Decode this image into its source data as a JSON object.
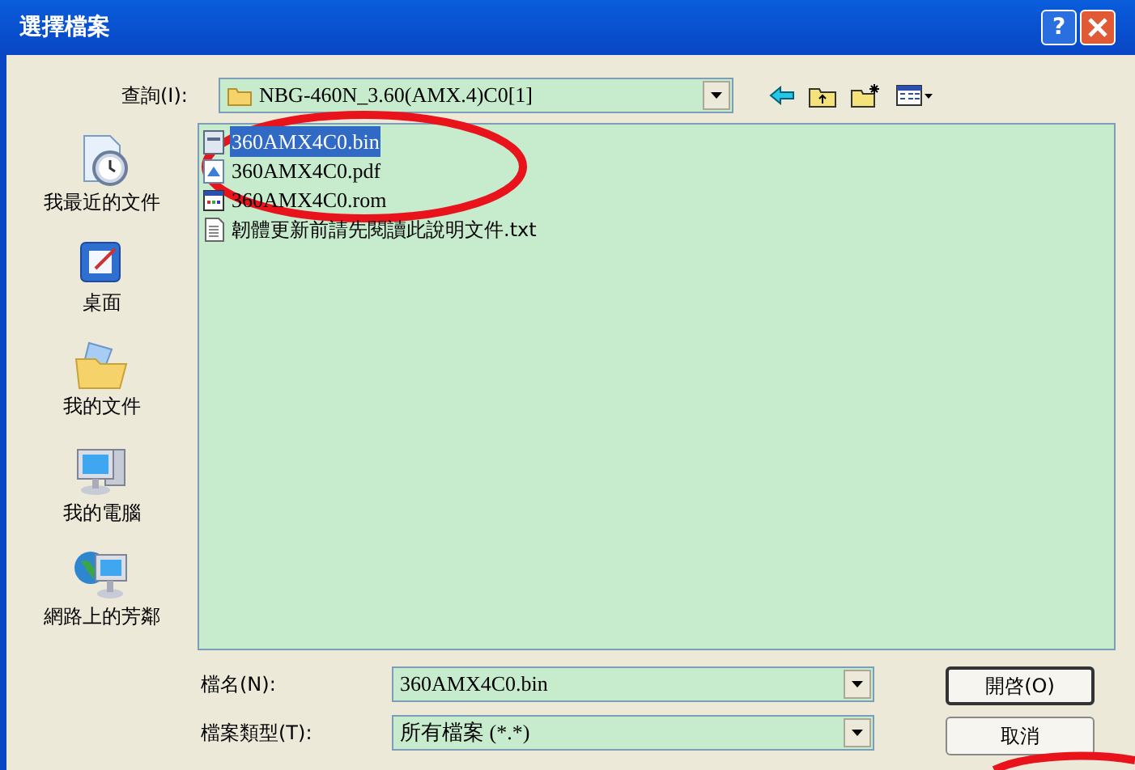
{
  "window": {
    "title": "選擇檔案",
    "help_button": "?"
  },
  "look_in": {
    "label": "查詢(I):",
    "value": "NBG-460N_3.60(AMX.4)C0[1]"
  },
  "places": [
    {
      "kind": "recent",
      "label": "我最近的文件"
    },
    {
      "kind": "desktop",
      "label": "桌面"
    },
    {
      "kind": "documents",
      "label": "我的文件"
    },
    {
      "kind": "computer",
      "label": "我的電腦"
    },
    {
      "kind": "network",
      "label": "網路上的芳鄰"
    }
  ],
  "files": [
    {
      "kind": "bin",
      "name": "360AMX4C0.bin",
      "selected": true
    },
    {
      "kind": "pdf",
      "name": "360AMX4C0.pdf",
      "selected": false
    },
    {
      "kind": "rom",
      "name": "360AMX4C0.rom",
      "selected": false
    },
    {
      "kind": "txt",
      "name": "韌體更新前請先閱讀此說明文件.txt",
      "selected": false
    }
  ],
  "file_name": {
    "label": "檔名(N):",
    "value": "360AMX4C0.bin"
  },
  "file_type": {
    "label": "檔案類型(T):",
    "value": "所有檔案 (*.*)"
  },
  "buttons": [
    {
      "label": "開啓(O)",
      "default": true
    },
    {
      "label": "取消",
      "default": false
    }
  ]
}
